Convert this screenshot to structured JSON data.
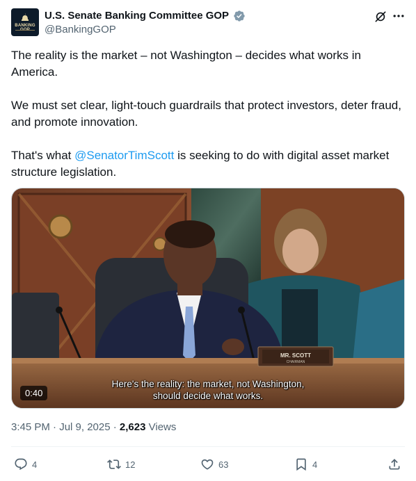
{
  "account": {
    "name": "U.S. Senate Banking Committee GOP",
    "handle": "@BankingGOP",
    "avatar_text": "BANKING GOP"
  },
  "post": {
    "para1": "The reality is the market – not Washington – decides what works in America.",
    "para2": "We must set clear, light-touch guardrails that protect investors, deter fraud, and promote innovation.",
    "para3_before": "That's what ",
    "para3_mention": "@SenatorTimScott",
    "para3_after": " is seeking to do with digital asset market structure legislation."
  },
  "video": {
    "duration": "0:40",
    "caption_line1": "Here's the reality: the market, not Washington,",
    "caption_line2": "should decide what works.",
    "nameplate_line1": "MR. SCOTT",
    "nameplate_line2": "CHAIRMAN"
  },
  "meta": {
    "time": "3:45 PM · Jul 9, 2025 · ",
    "views_count": "2,623",
    "views_label": " Views"
  },
  "actions": {
    "replies": "4",
    "reposts": "12",
    "likes": "63",
    "bookmarks": "4"
  },
  "colors": {
    "accent": "#1d9bf0",
    "verified": "#829aab",
    "text": "#0f1419",
    "muted": "#536471"
  }
}
